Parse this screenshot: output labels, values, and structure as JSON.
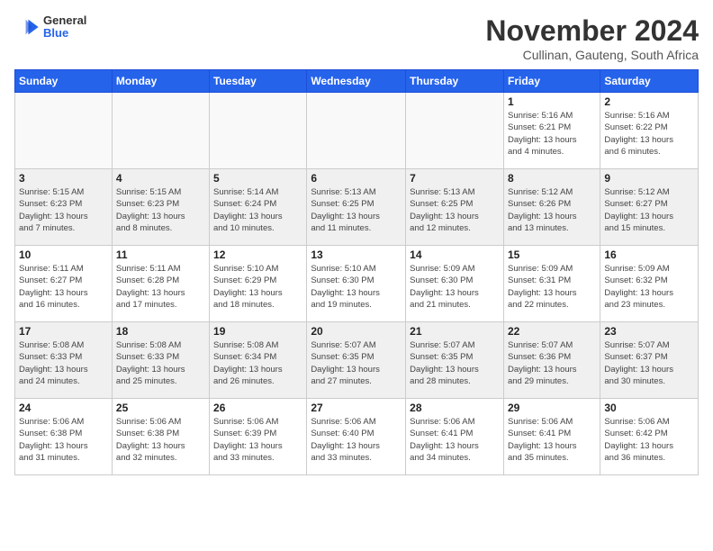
{
  "logo": {
    "general": "General",
    "blue": "Blue"
  },
  "header": {
    "month": "November 2024",
    "location": "Cullinan, Gauteng, South Africa"
  },
  "days_of_week": [
    "Sunday",
    "Monday",
    "Tuesday",
    "Wednesday",
    "Thursday",
    "Friday",
    "Saturday"
  ],
  "weeks": [
    {
      "days": [
        {
          "num": "",
          "info": ""
        },
        {
          "num": "",
          "info": ""
        },
        {
          "num": "",
          "info": ""
        },
        {
          "num": "",
          "info": ""
        },
        {
          "num": "",
          "info": ""
        },
        {
          "num": "1",
          "info": "Sunrise: 5:16 AM\nSunset: 6:21 PM\nDaylight: 13 hours\nand 4 minutes."
        },
        {
          "num": "2",
          "info": "Sunrise: 5:16 AM\nSunset: 6:22 PM\nDaylight: 13 hours\nand 6 minutes."
        }
      ]
    },
    {
      "days": [
        {
          "num": "3",
          "info": "Sunrise: 5:15 AM\nSunset: 6:23 PM\nDaylight: 13 hours\nand 7 minutes."
        },
        {
          "num": "4",
          "info": "Sunrise: 5:15 AM\nSunset: 6:23 PM\nDaylight: 13 hours\nand 8 minutes."
        },
        {
          "num": "5",
          "info": "Sunrise: 5:14 AM\nSunset: 6:24 PM\nDaylight: 13 hours\nand 10 minutes."
        },
        {
          "num": "6",
          "info": "Sunrise: 5:13 AM\nSunset: 6:25 PM\nDaylight: 13 hours\nand 11 minutes."
        },
        {
          "num": "7",
          "info": "Sunrise: 5:13 AM\nSunset: 6:25 PM\nDaylight: 13 hours\nand 12 minutes."
        },
        {
          "num": "8",
          "info": "Sunrise: 5:12 AM\nSunset: 6:26 PM\nDaylight: 13 hours\nand 13 minutes."
        },
        {
          "num": "9",
          "info": "Sunrise: 5:12 AM\nSunset: 6:27 PM\nDaylight: 13 hours\nand 15 minutes."
        }
      ]
    },
    {
      "days": [
        {
          "num": "10",
          "info": "Sunrise: 5:11 AM\nSunset: 6:27 PM\nDaylight: 13 hours\nand 16 minutes."
        },
        {
          "num": "11",
          "info": "Sunrise: 5:11 AM\nSunset: 6:28 PM\nDaylight: 13 hours\nand 17 minutes."
        },
        {
          "num": "12",
          "info": "Sunrise: 5:10 AM\nSunset: 6:29 PM\nDaylight: 13 hours\nand 18 minutes."
        },
        {
          "num": "13",
          "info": "Sunrise: 5:10 AM\nSunset: 6:30 PM\nDaylight: 13 hours\nand 19 minutes."
        },
        {
          "num": "14",
          "info": "Sunrise: 5:09 AM\nSunset: 6:30 PM\nDaylight: 13 hours\nand 21 minutes."
        },
        {
          "num": "15",
          "info": "Sunrise: 5:09 AM\nSunset: 6:31 PM\nDaylight: 13 hours\nand 22 minutes."
        },
        {
          "num": "16",
          "info": "Sunrise: 5:09 AM\nSunset: 6:32 PM\nDaylight: 13 hours\nand 23 minutes."
        }
      ]
    },
    {
      "days": [
        {
          "num": "17",
          "info": "Sunrise: 5:08 AM\nSunset: 6:33 PM\nDaylight: 13 hours\nand 24 minutes."
        },
        {
          "num": "18",
          "info": "Sunrise: 5:08 AM\nSunset: 6:33 PM\nDaylight: 13 hours\nand 25 minutes."
        },
        {
          "num": "19",
          "info": "Sunrise: 5:08 AM\nSunset: 6:34 PM\nDaylight: 13 hours\nand 26 minutes."
        },
        {
          "num": "20",
          "info": "Sunrise: 5:07 AM\nSunset: 6:35 PM\nDaylight: 13 hours\nand 27 minutes."
        },
        {
          "num": "21",
          "info": "Sunrise: 5:07 AM\nSunset: 6:35 PM\nDaylight: 13 hours\nand 28 minutes."
        },
        {
          "num": "22",
          "info": "Sunrise: 5:07 AM\nSunset: 6:36 PM\nDaylight: 13 hours\nand 29 minutes."
        },
        {
          "num": "23",
          "info": "Sunrise: 5:07 AM\nSunset: 6:37 PM\nDaylight: 13 hours\nand 30 minutes."
        }
      ]
    },
    {
      "days": [
        {
          "num": "24",
          "info": "Sunrise: 5:06 AM\nSunset: 6:38 PM\nDaylight: 13 hours\nand 31 minutes."
        },
        {
          "num": "25",
          "info": "Sunrise: 5:06 AM\nSunset: 6:38 PM\nDaylight: 13 hours\nand 32 minutes."
        },
        {
          "num": "26",
          "info": "Sunrise: 5:06 AM\nSunset: 6:39 PM\nDaylight: 13 hours\nand 33 minutes."
        },
        {
          "num": "27",
          "info": "Sunrise: 5:06 AM\nSunset: 6:40 PM\nDaylight: 13 hours\nand 33 minutes."
        },
        {
          "num": "28",
          "info": "Sunrise: 5:06 AM\nSunset: 6:41 PM\nDaylight: 13 hours\nand 34 minutes."
        },
        {
          "num": "29",
          "info": "Sunrise: 5:06 AM\nSunset: 6:41 PM\nDaylight: 13 hours\nand 35 minutes."
        },
        {
          "num": "30",
          "info": "Sunrise: 5:06 AM\nSunset: 6:42 PM\nDaylight: 13 hours\nand 36 minutes."
        }
      ]
    }
  ]
}
